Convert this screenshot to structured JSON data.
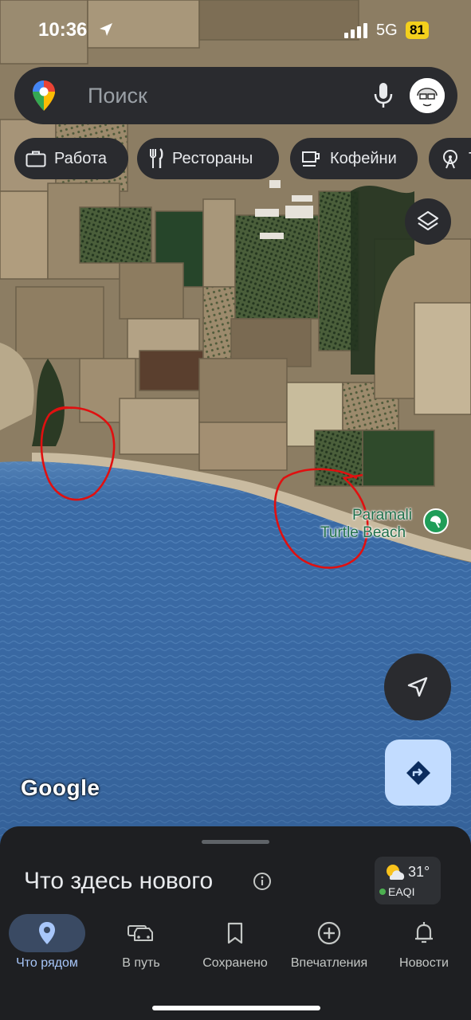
{
  "status_bar": {
    "time": "10:36",
    "network": "5G",
    "battery": "81"
  },
  "search": {
    "placeholder": "Поиск"
  },
  "chips": [
    {
      "label": "Работа",
      "icon": "briefcase-icon"
    },
    {
      "label": "Рестораны",
      "icon": "fork-knife-icon"
    },
    {
      "label": "Кофейни",
      "icon": "coffee-cup-icon"
    },
    {
      "label": "Т",
      "icon": "attraction-icon"
    }
  ],
  "map": {
    "place_name_line1": "Paramali",
    "place_name_line2": "Turtle Beach",
    "place_icon": "beach-umbrella-icon",
    "attribution": "Google",
    "colors": {
      "sea": "#3d6ea8",
      "land": "#8a7b62",
      "fields": "#3c5a34",
      "annotation": "#e01010",
      "place_label": "#1f6f4a"
    }
  },
  "sheet": {
    "title": "Что здесь нового",
    "weather": {
      "temp": "31°",
      "aqi_label": "EAQI",
      "icon": "partly-sunny-icon"
    }
  },
  "bottom_nav": [
    {
      "label": "Что рядом",
      "icon": "location-pin-icon",
      "active": true
    },
    {
      "label": "В путь",
      "icon": "car-icon",
      "active": false
    },
    {
      "label": "Сохранено",
      "icon": "bookmark-icon",
      "active": false
    },
    {
      "label": "Впечатления",
      "icon": "add-circle-icon",
      "active": false
    },
    {
      "label": "Новости",
      "icon": "bell-icon",
      "active": false
    }
  ],
  "colors": {
    "accent": "#a8c7fa",
    "directions_button": "#c2dcff",
    "panel": "#2a2b2f"
  }
}
